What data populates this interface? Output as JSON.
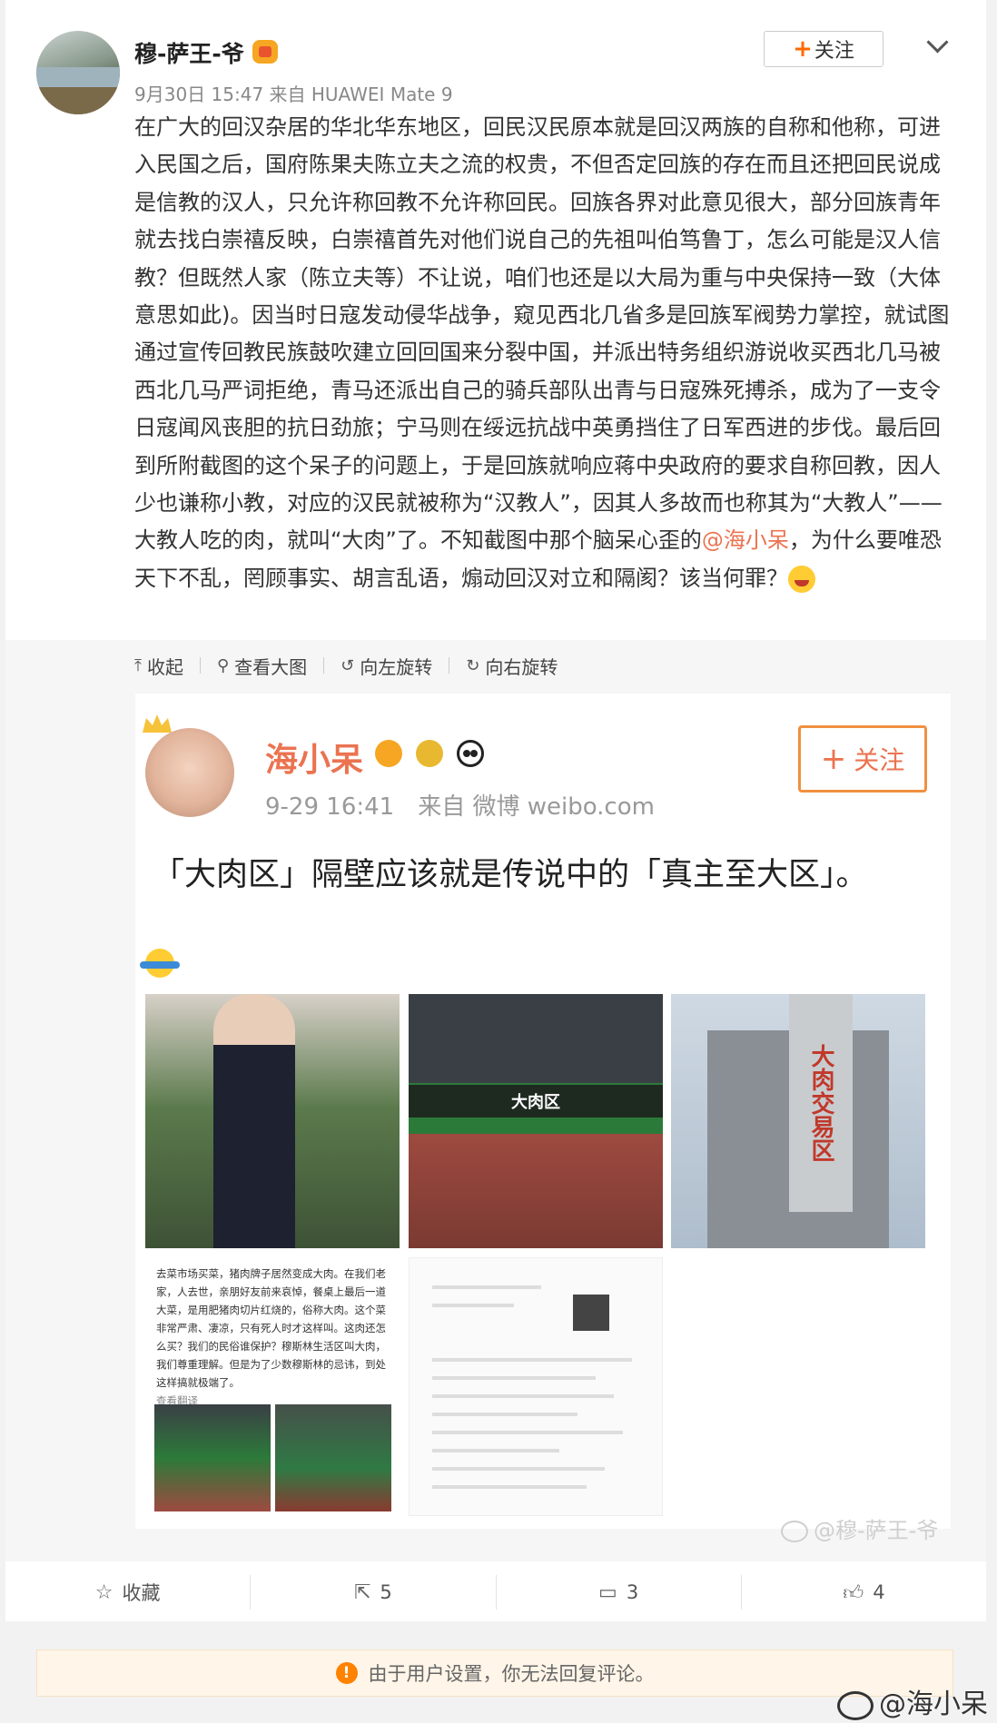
{
  "post": {
    "username": "穆-萨王-爷",
    "meta": "9月30日 15:47 来自 HUAWEI Mate 9",
    "follow_label": "关注",
    "text_part1": "在广大的回汉杂居的华北华东地区，回民汉民原本就是回汉两族的自称和他称，可进入民国之后，国府陈果夫陈立夫之流的权贵，不但否定回族的存在而且还把回民说成是信教的汉人，只允许称回教不允许称回民。回族各界对此意见很大，部分回族青年就去找白崇禧反映，白崇禧首先对他们说自己的先祖叫伯笃鲁丁，怎么可能是汉人信教？但既然人家（陈立夫等）不让说，咱们也还是以大局为重与中央保持一致（大体意思如此)。因当时日寇发动侵华战争，窥见西北几省多是回族军阀势力掌控，就试图通过宣传回教民族鼓吹建立回回国来分裂中国，并派出特务组织游说收买西北几马被西北几马严词拒绝，青马还派出自己的骑兵部队出青与日寇殊死搏杀，成为了一支令日寇闻风丧胆的抗日劲旅；宁马则在绥远抗战中英勇挡住了日军西进的步伐。最后回到所附截图的这个呆子的问题上，于是回族就响应蒋中央政府的要求自称回教，因人少也谦称小教，对应的汉民就被称为“汉教人”，因其人多故而也称其为“大教人”——大教人吃的肉，就叫“大肉”了。不知截图中那个脑呆心歪的",
    "mention": "@海小呆",
    "text_part2": "，为什么要唯恐天下不乱，罔顾事实、胡言乱语，煽动回汉对立和隔阂？该当何罪？"
  },
  "media_tools": {
    "collapse": "收起",
    "view_large": "查看大图",
    "rotate_left": "向左旋转",
    "rotate_right": "向右旋转"
  },
  "screenshot": {
    "name": "海小呆",
    "meta": "9-29 16:41　来自 微博 weibo.com",
    "follow": "关注",
    "text": "「大肉区」隔壁应该就是传说中的「真主至大区」。",
    "photo2_sign": "大肉区",
    "photo3_sign": "大肉交易区",
    "doc_text": "去菜市场买菜，猪肉牌子居然变成大肉。在我们老家，人去世，亲朋好友前来哀悼，餐桌上最后一道大菜，是用肥猪肉切片红烧的，俗称大肉。这个菜非常严肃、凄凉，只有死人时才这样叫。这肉还怎么买？我们的民俗谁保护？穆斯林生活区叫大肉，我们尊重理解。但是为了少数穆斯林的忌讳，到处这样搞就极端了。",
    "doc_more": "查看翻译"
  },
  "watermark": "@穆-萨王-爷",
  "actions": {
    "favorite": "收藏",
    "repost": "5",
    "comment": "3",
    "like": "4"
  },
  "notice": "由于用户设置，你无法回复评论。",
  "corner_watermark": "@海小呆",
  "icons": [
    "vip-crown-icon",
    "chevron-down-icon",
    "laugh-cry-emoji-icon",
    "arrow-up-icon",
    "search-icon",
    "rotate-left-icon",
    "rotate-right-icon",
    "star-icon",
    "share-icon",
    "comment-icon",
    "thumbs-up-icon",
    "warning-icon",
    "weibo-logo-icon"
  ],
  "colors": {
    "accent": "#eb7350",
    "follow_plus": "#ff6a00",
    "notice_bg": "#fff5e8",
    "warning": "#ff8200"
  }
}
